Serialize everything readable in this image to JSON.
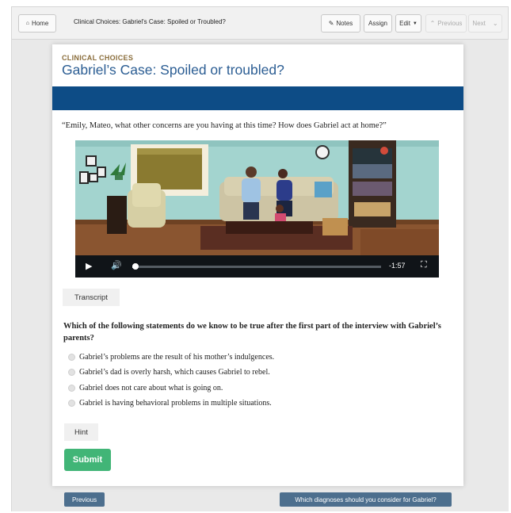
{
  "toolbar": {
    "home_label": "Home",
    "home_icon": "home-icon",
    "breadcrumb": "Clinical Choices: Gabriel's Case: Spoiled or Troubled?",
    "notes_label": "Notes",
    "notes_icon": "pencil-icon",
    "assign_label": "Assign",
    "edit_label": "Edit",
    "previous_label": "Previous",
    "next_label": "Next"
  },
  "card": {
    "eyebrow": "CLINICAL CHOICES",
    "title": "Gabriel’s Case: Spoiled or troubled?",
    "quote": "“Emily, Mateo, what other concerns are you having at this time? How does Gabriel act at home?”"
  },
  "video": {
    "time_remaining": "-1:57",
    "progress": 0.02
  },
  "transcript_label": "Transcript",
  "quiz": {
    "question": "Which of the following statements do we know to be true after the first part of the interview with Gabriel’s parents?",
    "options": [
      "Gabriel’s problems are the result of his mother’s indulgences.",
      "Gabriel’s dad is overly harsh, which causes Gabriel to rebel.",
      "Gabriel does not care about what is going on.",
      "Gabriel is having behavioral problems in multiple situations."
    ],
    "hint_label": "Hint",
    "submit_label": "Submit"
  },
  "footer_nav": {
    "previous_label": "Previous",
    "next_label": "Which diagnoses should you consider for Gabriel?"
  },
  "colors": {
    "title_blue": "#2b5d93",
    "banner_blue": "#0d4c86",
    "submit_green": "#41b577",
    "nav_button": "#4d6f8e"
  }
}
